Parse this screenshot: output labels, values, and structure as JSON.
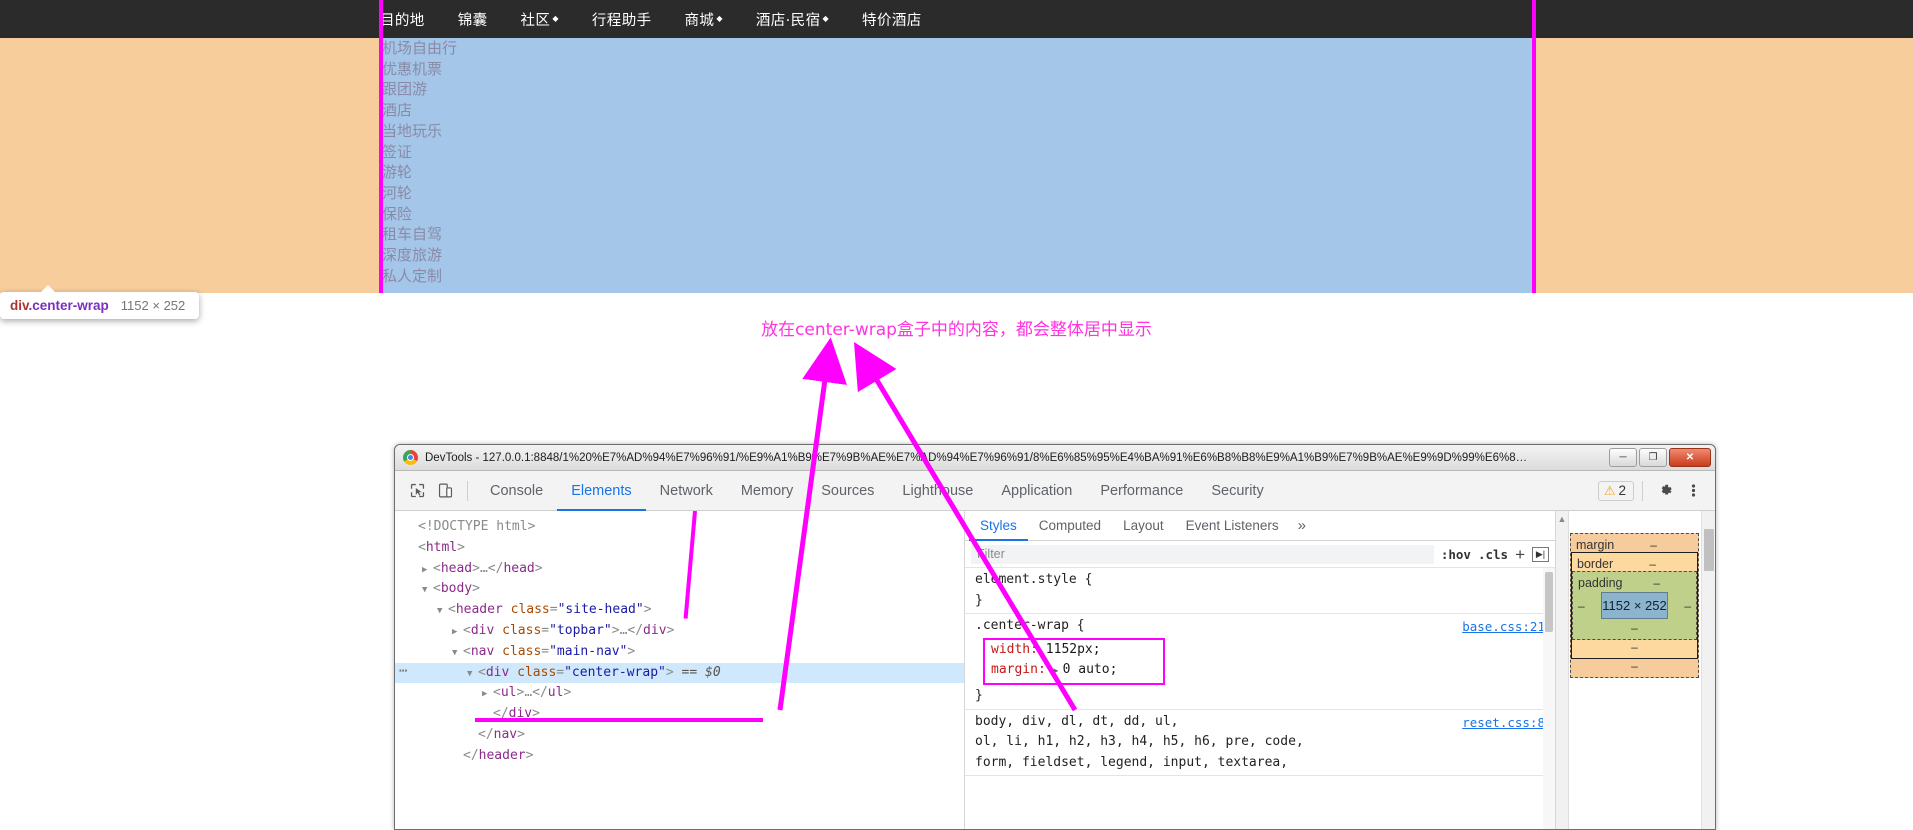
{
  "page": {
    "topnav": [
      {
        "label": "目的地",
        "caret": false
      },
      {
        "label": "锦囊",
        "caret": false
      },
      {
        "label": "社区",
        "caret": true
      },
      {
        "label": "行程助手",
        "caret": false
      },
      {
        "label": "商城",
        "caret": true
      },
      {
        "label": "酒店·民宿",
        "caret": true
      },
      {
        "label": "特价酒店",
        "caret": false
      }
    ],
    "side_list": [
      "机场自由行",
      "优惠机票",
      "跟团游",
      "酒店",
      "当地玩乐",
      "签证",
      "游轮",
      "河轮",
      "保险",
      "租车自驾",
      "深度旅游",
      "私人定制"
    ],
    "inspect_tooltip": {
      "tag": "div",
      "class": ".center-wrap",
      "dims": "1152 × 252"
    },
    "annotation": "放在center-wrap盒子中的内容，都会整体居中显示",
    "colors": {
      "topbar_bg": "#2b2b2b",
      "highlight_content": "#a4c6e8",
      "highlight_margin": "#f7cd9c",
      "guide": "#ff00ff"
    }
  },
  "devtools": {
    "window_title": "DevTools - 127.0.0.1:8848/1%20%E7%AD%94%E7%96%91/%E9%A1%B9%E7%9B%AE%E7%AD%94%E7%96%91/8%E6%85%95%E4%BA%91%E6%B8%B8%E9%A1%B9%E7%9B%AE%E9%9D%99%E6%8…",
    "window_buttons": {
      "minimize": "─",
      "maximize": "❐",
      "close": "✕"
    },
    "toolbar_icons": [
      "inspect-cursor-icon",
      "device-toolbar-icon"
    ],
    "tabs": [
      {
        "label": "Console",
        "active": false
      },
      {
        "label": "Elements",
        "active": true
      },
      {
        "label": "Network",
        "active": false
      },
      {
        "label": "Memory",
        "active": false
      },
      {
        "label": "Sources",
        "active": false
      },
      {
        "label": "Lighthouse",
        "active": false
      },
      {
        "label": "Application",
        "active": false
      },
      {
        "label": "Performance",
        "active": false
      },
      {
        "label": "Security",
        "active": false
      }
    ],
    "warning_count": "2",
    "warning_glyph": "⚠",
    "settings_icon": "gear-icon",
    "more_icon": "kebab-menu-icon",
    "dom_tree": [
      {
        "indent": 0,
        "twisty": "",
        "segments": [
          {
            "t": "doctype",
            "v": "<!DOCTYPE html>"
          }
        ]
      },
      {
        "indent": 0,
        "twisty": "",
        "segments": [
          {
            "t": "punc",
            "v": "<"
          },
          {
            "t": "tag",
            "v": "html"
          },
          {
            "t": "punc",
            "v": ">"
          }
        ]
      },
      {
        "indent": 1,
        "twisty": "▶",
        "segments": [
          {
            "t": "punc",
            "v": "<"
          },
          {
            "t": "tag",
            "v": "head"
          },
          {
            "t": "punc",
            "v": ">"
          },
          {
            "t": "grey",
            "v": "…"
          },
          {
            "t": "punc",
            "v": "</"
          },
          {
            "t": "tag",
            "v": "head"
          },
          {
            "t": "punc",
            "v": ">"
          }
        ]
      },
      {
        "indent": 1,
        "twisty": "▼",
        "segments": [
          {
            "t": "punc",
            "v": "<"
          },
          {
            "t": "tag",
            "v": "body"
          },
          {
            "t": "punc",
            "v": ">"
          }
        ]
      },
      {
        "indent": 2,
        "twisty": "▼",
        "segments": [
          {
            "t": "punc",
            "v": "<"
          },
          {
            "t": "tag",
            "v": "header"
          },
          {
            "t": "sp",
            "v": " "
          },
          {
            "t": "name",
            "v": "class"
          },
          {
            "t": "punc",
            "v": "="
          },
          {
            "t": "val",
            "v": "\"site-head\""
          },
          {
            "t": "punc",
            "v": ">"
          }
        ]
      },
      {
        "indent": 3,
        "twisty": "▶",
        "segments": [
          {
            "t": "punc",
            "v": "<"
          },
          {
            "t": "tag",
            "v": "div"
          },
          {
            "t": "sp",
            "v": " "
          },
          {
            "t": "name",
            "v": "class"
          },
          {
            "t": "punc",
            "v": "="
          },
          {
            "t": "val",
            "v": "\"topbar\""
          },
          {
            "t": "punc",
            "v": ">"
          },
          {
            "t": "grey",
            "v": "…"
          },
          {
            "t": "punc",
            "v": "</"
          },
          {
            "t": "tag",
            "v": "div"
          },
          {
            "t": "punc",
            "v": ">"
          }
        ]
      },
      {
        "indent": 3,
        "twisty": "▼",
        "segments": [
          {
            "t": "punc",
            "v": "<"
          },
          {
            "t": "tag",
            "v": "nav"
          },
          {
            "t": "sp",
            "v": " "
          },
          {
            "t": "name",
            "v": "class"
          },
          {
            "t": "punc",
            "v": "="
          },
          {
            "t": "val",
            "v": "\"main-nav\""
          },
          {
            "t": "punc",
            "v": ">"
          }
        ]
      },
      {
        "indent": 4,
        "twisty": "▼",
        "selected": true,
        "dots": "⋯",
        "segments": [
          {
            "t": "punc",
            "v": "<"
          },
          {
            "t": "tag",
            "v": "div"
          },
          {
            "t": "sp",
            "v": " "
          },
          {
            "t": "name",
            "v": "class"
          },
          {
            "t": "punc",
            "v": "="
          },
          {
            "t": "val",
            "v": "\"center-wrap\""
          },
          {
            "t": "punc",
            "v": ">"
          },
          {
            "t": "sel",
            "v": " == $0"
          }
        ]
      },
      {
        "indent": 5,
        "twisty": "▶",
        "segments": [
          {
            "t": "punc",
            "v": "<"
          },
          {
            "t": "tag",
            "v": "ul"
          },
          {
            "t": "punc",
            "v": ">"
          },
          {
            "t": "grey",
            "v": "…"
          },
          {
            "t": "punc",
            "v": "</"
          },
          {
            "t": "tag",
            "v": "ul"
          },
          {
            "t": "punc",
            "v": ">"
          }
        ]
      },
      {
        "indent": 5,
        "twisty": "",
        "segments": [
          {
            "t": "punc",
            "v": "</"
          },
          {
            "t": "tag",
            "v": "div"
          },
          {
            "t": "punc",
            "v": ">"
          }
        ]
      },
      {
        "indent": 4,
        "twisty": "",
        "segments": [
          {
            "t": "punc",
            "v": "</"
          },
          {
            "t": "tag",
            "v": "nav"
          },
          {
            "t": "punc",
            "v": ">"
          }
        ]
      },
      {
        "indent": 3,
        "twisty": "",
        "segments": [
          {
            "t": "punc",
            "v": "</"
          },
          {
            "t": "tag",
            "v": "header"
          },
          {
            "t": "punc",
            "v": ">"
          }
        ]
      }
    ],
    "styles": {
      "tabs": [
        {
          "label": "Styles",
          "active": true
        },
        {
          "label": "Computed",
          "active": false
        },
        {
          "label": "Layout",
          "active": false
        },
        {
          "label": "Event Listeners",
          "active": false
        }
      ],
      "more_glyph": "»",
      "filter_placeholder": "Filter",
      "hov_label": ":hov",
      "cls_label": ".cls",
      "plus_glyph": "+",
      "rules": [
        {
          "selector": "element.style {",
          "close": "}",
          "source": "",
          "declarations": []
        },
        {
          "selector": ".center-wrap {",
          "close": "}",
          "source": "base.css:21",
          "highlighted": true,
          "declarations": [
            {
              "name": "width",
              "value": "1152px;",
              "expand": false
            },
            {
              "name": "margin",
              "value": "0 auto;",
              "expand": true
            }
          ]
        },
        {
          "selector": "body, div, dl, dt, dd, ul,",
          "selector_line2": "ol, li, h1, h2, h3, h4, h5, h6, pre, code,",
          "selector_line3": "form, fieldset, legend, input, textarea,",
          "source": "reset.css:8",
          "declarations": []
        }
      ]
    },
    "box_model": {
      "margin_label": "margin",
      "border_label": "border",
      "padding_label": "padding",
      "content_size": "1152 × 252",
      "dash": "–"
    }
  }
}
